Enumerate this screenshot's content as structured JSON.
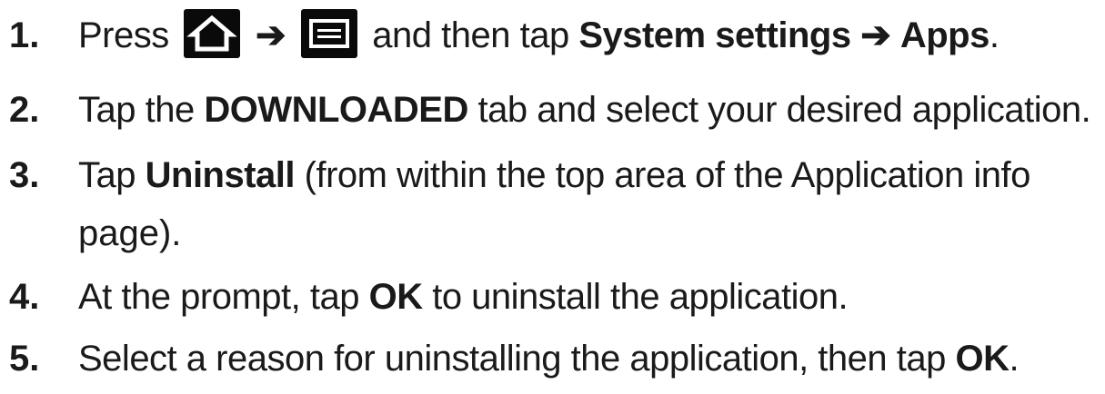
{
  "steps": [
    {
      "number": "1.",
      "pre": "Press",
      "icon1": "home-icon",
      "arrow": "➔",
      "icon2": "menu-icon",
      "mid": "and then tap",
      "bold1": "System settings",
      "arrow2": "➔",
      "bold2": "Apps",
      "post": "."
    },
    {
      "number": "2.",
      "pre": "Tap the",
      "bold": "DOWNLOADED",
      "post": "tab and select your desired application."
    },
    {
      "number": "3.",
      "pre": "Tap",
      "bold": "Uninstall",
      "post": "(from within the top area of the Application info",
      "cont": "page)."
    },
    {
      "number": "4.",
      "pre": "At the prompt, tap",
      "bold": "OK",
      "post": "to uninstall the application."
    },
    {
      "number": "5.",
      "pre": "Select a reason for uninstalling the application, then tap",
      "bold": "OK",
      "post": "."
    }
  ]
}
